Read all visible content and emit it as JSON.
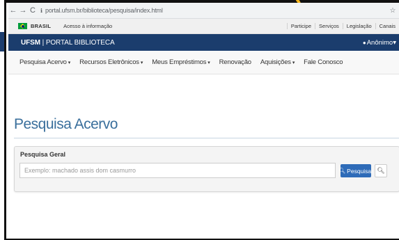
{
  "browser": {
    "back": "←",
    "forward": "→",
    "reload": "C",
    "url": "portal.ufsm.br/biblioteca/pesquisa/index.html",
    "bookmark": "☆"
  },
  "gov_bar": {
    "brasil": "BRASIL",
    "acesso": "Acesso à informação",
    "links": [
      "Participe",
      "Serviços",
      "Legislação",
      "Canais"
    ]
  },
  "brand_bar": {
    "org": "UFSM",
    "separator": "|",
    "portal": "PORTAL BIBLIOTECA",
    "user": "Anônimo",
    "user_caret": "▾"
  },
  "menu": {
    "items": [
      {
        "label": "Pesquisa Acervo",
        "caret": "▾"
      },
      {
        "label": "Recursos Eletrônicos",
        "caret": "▾"
      },
      {
        "label": "Meus Empréstimos",
        "caret": "▾"
      },
      {
        "label": "Renovação",
        "caret": ""
      },
      {
        "label": "Aquisições",
        "caret": "▾"
      },
      {
        "label": "Fale Conosco",
        "caret": ""
      }
    ]
  },
  "page": {
    "title": "Pesquisa Acervo"
  },
  "search": {
    "panel_label": "Pesquisa Geral",
    "placeholder": "Exemplo: machado assis dom casmurro",
    "button_label": "Pesquisar"
  },
  "colors": {
    "brand_bar": "#1b3d6d",
    "title": "#3a6f9c",
    "search_button": "#2e6bb8",
    "deco_yellow": "#f5b51b"
  }
}
